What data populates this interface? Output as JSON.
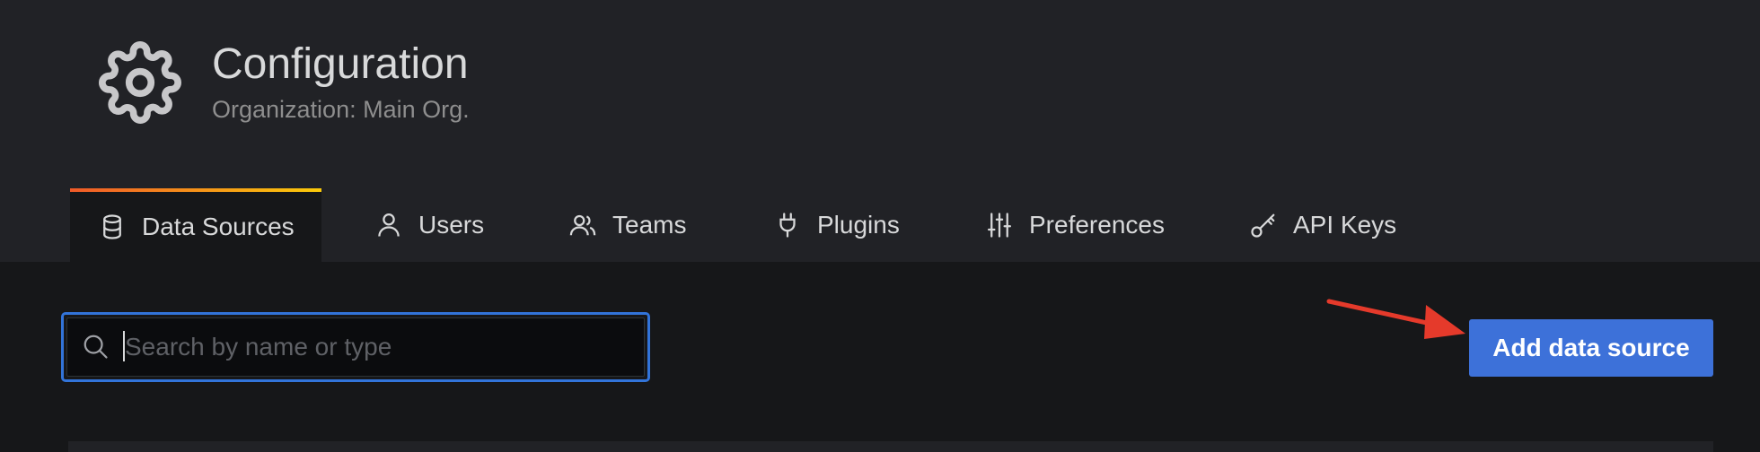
{
  "header": {
    "title": "Configuration",
    "subtitle": "Organization: Main Org."
  },
  "tabs": [
    {
      "label": "Data Sources",
      "icon": "database-icon",
      "active": true
    },
    {
      "label": "Users",
      "icon": "user-icon",
      "active": false
    },
    {
      "label": "Teams",
      "icon": "users-icon",
      "active": false
    },
    {
      "label": "Plugins",
      "icon": "plug-icon",
      "active": false
    },
    {
      "label": "Preferences",
      "icon": "sliders-icon",
      "active": false
    },
    {
      "label": "API Keys",
      "icon": "key-icon",
      "active": false
    }
  ],
  "search": {
    "placeholder": "Search by name or type",
    "value": ""
  },
  "actions": {
    "add_label": "Add data source"
  },
  "colors": {
    "header_bg": "#212226",
    "page_bg": "#161719",
    "accent_blue": "#3d71d9",
    "tab_gradient_start": "#f05a28",
    "tab_gradient_end": "#fbca0a",
    "annotation_arrow": "#e53a2b"
  }
}
